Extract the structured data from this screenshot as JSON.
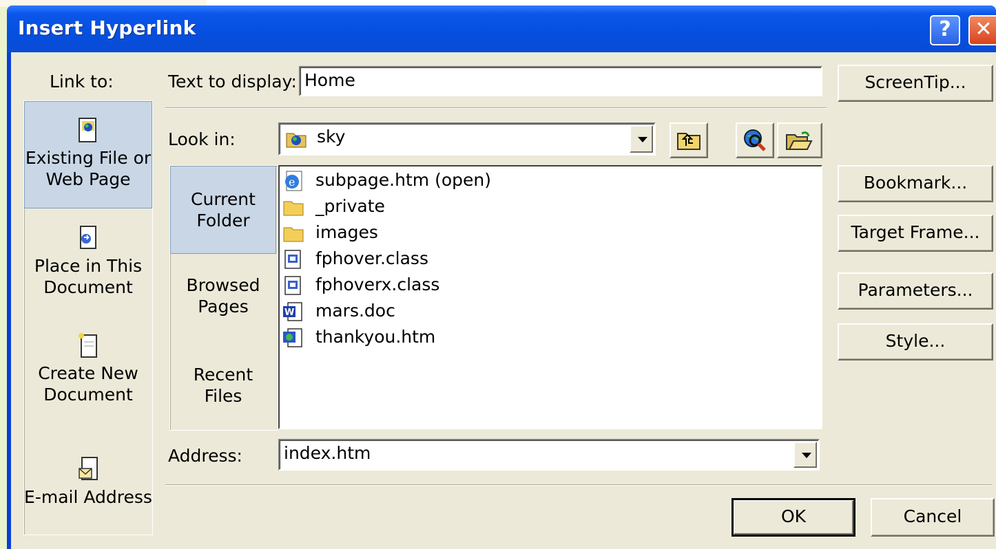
{
  "window": {
    "title": "Insert Hyperlink",
    "help_glyph": "?",
    "close_glyph": "✕"
  },
  "link_to": {
    "label": "Link to:",
    "items": [
      {
        "line1": "Existing File or",
        "line2": "Web Page",
        "icon": "existing-file-icon",
        "selected": true
      },
      {
        "line1": "Place in This",
        "line2": "Document",
        "icon": "place-in-document-icon",
        "selected": false
      },
      {
        "line1": "Create New",
        "line2": "Document",
        "icon": "create-new-document-icon",
        "selected": false
      },
      {
        "line1": "E-mail Address",
        "line2": "",
        "icon": "email-address-icon",
        "selected": false
      }
    ]
  },
  "text_to_display": {
    "label": "Text to display:",
    "value": "Home"
  },
  "look_in": {
    "label": "Look in:",
    "value": "sky",
    "icon": "web-folder-icon"
  },
  "sub_tabs": [
    {
      "line1": "Current",
      "line2": "Folder",
      "selected": true
    },
    {
      "line1": "Browsed",
      "line2": "Pages",
      "selected": false
    },
    {
      "line1": "Recent",
      "line2": "Files",
      "selected": false
    }
  ],
  "files": [
    {
      "name": "subpage.htm (open)",
      "icon": "ie-page-icon"
    },
    {
      "name": "_private",
      "icon": "folder-icon"
    },
    {
      "name": "images",
      "icon": "folder-icon"
    },
    {
      "name": "fphover.class",
      "icon": "class-file-icon"
    },
    {
      "name": "fphoverx.class",
      "icon": "class-file-icon"
    },
    {
      "name": "mars.doc",
      "icon": "word-doc-icon"
    },
    {
      "name": "thankyou.htm",
      "icon": "htm-file-icon"
    }
  ],
  "address": {
    "label": "Address:",
    "value": "index.htm"
  },
  "buttons": {
    "screentip": "ScreenTip...",
    "bookmark": "Bookmark...",
    "target_frame": "Target Frame...",
    "parameters": "Parameters...",
    "style": "Style...",
    "ok": "OK",
    "cancel": "Cancel"
  },
  "colors": {
    "title_bar": "#0550e0",
    "dialog_face": "#ece9d8",
    "selected_item": "#c9d6e6",
    "close_button": "#d9431d"
  }
}
